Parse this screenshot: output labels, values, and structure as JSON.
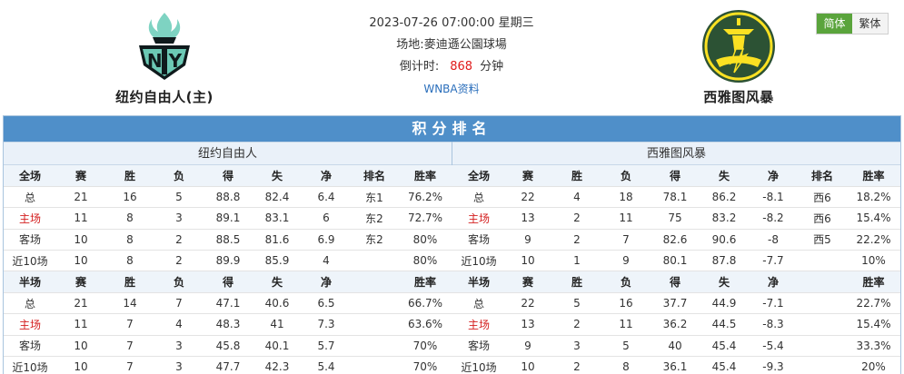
{
  "colors": {
    "title_bar": "#4f8fc9",
    "lang_active": "#5aa43c",
    "home_text": "#d42020",
    "countdown": "#e01b1b",
    "link": "#2a6ebb"
  },
  "match": {
    "datetime": "2023-07-26 07:00:00 星期三",
    "venue_label": "场地:",
    "venue": "麥迪遜公園球場",
    "countdown_label": "倒计时:",
    "countdown_value": "868",
    "countdown_unit": "分钟",
    "league_link": "WNBA资料"
  },
  "home_team": {
    "name": "纽约自由人(主)",
    "logo_icon": "new-york-liberty-logo-icon"
  },
  "away_team": {
    "name": "西雅图风暴",
    "logo_icon": "seattle-storm-logo-icon"
  },
  "lang_switch": {
    "simplified": "简体",
    "traditional": "繁体"
  },
  "standings": {
    "title": "积分排名",
    "home": {
      "name": "纽约自由人",
      "full_header": [
        "全场",
        "赛",
        "胜",
        "负",
        "得",
        "失",
        "净",
        "排名",
        "胜率"
      ],
      "full_rows": [
        [
          "总",
          "21",
          "16",
          "5",
          "88.8",
          "82.4",
          "6.4",
          "东1",
          "76.2%"
        ],
        [
          "主场",
          "11",
          "8",
          "3",
          "89.1",
          "83.1",
          "6",
          "东2",
          "72.7%"
        ],
        [
          "客场",
          "10",
          "8",
          "2",
          "88.5",
          "81.6",
          "6.9",
          "东2",
          "80%"
        ],
        [
          "近10场",
          "10",
          "8",
          "2",
          "89.9",
          "85.9",
          "4",
          "",
          "80%"
        ]
      ],
      "half_header": [
        "半场",
        "赛",
        "胜",
        "负",
        "得",
        "失",
        "净",
        "",
        "胜率"
      ],
      "half_rows": [
        [
          "总",
          "21",
          "14",
          "7",
          "47.1",
          "40.6",
          "6.5",
          "",
          "66.7%"
        ],
        [
          "主场",
          "11",
          "7",
          "4",
          "48.3",
          "41",
          "7.3",
          "",
          "63.6%"
        ],
        [
          "客场",
          "10",
          "7",
          "3",
          "45.8",
          "40.1",
          "5.7",
          "",
          "70%"
        ],
        [
          "近10场",
          "10",
          "7",
          "3",
          "47.7",
          "42.3",
          "5.4",
          "",
          "70%"
        ]
      ]
    },
    "away": {
      "name": "西雅图风暴",
      "full_header": [
        "全场",
        "赛",
        "胜",
        "负",
        "得",
        "失",
        "净",
        "排名",
        "胜率"
      ],
      "full_rows": [
        [
          "总",
          "22",
          "4",
          "18",
          "78.1",
          "86.2",
          "-8.1",
          "西6",
          "18.2%"
        ],
        [
          "主场",
          "13",
          "2",
          "11",
          "75",
          "83.2",
          "-8.2",
          "西6",
          "15.4%"
        ],
        [
          "客场",
          "9",
          "2",
          "7",
          "82.6",
          "90.6",
          "-8",
          "西5",
          "22.2%"
        ],
        [
          "近10场",
          "10",
          "1",
          "9",
          "80.1",
          "87.8",
          "-7.7",
          "",
          "10%"
        ]
      ],
      "half_header": [
        "半场",
        "赛",
        "胜",
        "负",
        "得",
        "失",
        "净",
        "",
        "胜率"
      ],
      "half_rows": [
        [
          "总",
          "22",
          "5",
          "16",
          "37.7",
          "44.9",
          "-7.1",
          "",
          "22.7%"
        ],
        [
          "主场",
          "13",
          "2",
          "11",
          "36.2",
          "44.5",
          "-8.3",
          "",
          "15.4%"
        ],
        [
          "客场",
          "9",
          "3",
          "5",
          "40",
          "45.4",
          "-5.4",
          "",
          "33.3%"
        ],
        [
          "近10场",
          "10",
          "2",
          "8",
          "36.1",
          "45.4",
          "-9.3",
          "",
          "20%"
        ]
      ]
    }
  }
}
